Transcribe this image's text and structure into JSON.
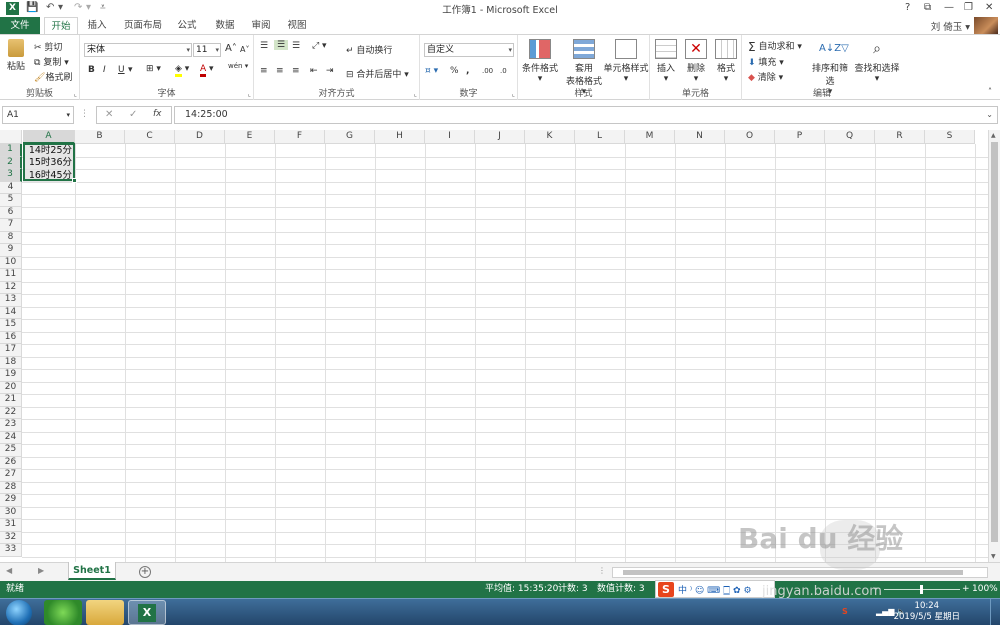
{
  "titlebar": {
    "title": "工作簿1 - Microsoft Excel",
    "help": "?",
    "ribbon_display": "⧉",
    "minimize": "—",
    "restore": "❐",
    "close": "✕"
  },
  "tabs": {
    "file": "文件",
    "items": [
      "开始",
      "插入",
      "页面布局",
      "公式",
      "数据",
      "审阅",
      "视图"
    ],
    "active": "开始",
    "user": "刘 倚玉 ▾"
  },
  "ribbon": {
    "clipboard": {
      "label": "剪贴板",
      "paste": "粘贴",
      "cut": "剪切",
      "copy": "复制",
      "format_painter": "格式刷"
    },
    "font": {
      "label": "字体",
      "font_name": "宋体",
      "font_size": "11",
      "bold": "B",
      "italic": "I",
      "underline": "U",
      "grow": "A",
      "shrink": "A",
      "wen": "wén"
    },
    "alignment": {
      "label": "对齐方式",
      "wrap": "自动换行",
      "merge": "合并后居中"
    },
    "number": {
      "label": "数字",
      "format": "自定义",
      "percent": "%",
      "comma": ",",
      "inc_dec": ".00",
      "dec_dec": ".0"
    },
    "styles": {
      "label": "样式",
      "cond": "条件格式",
      "table": "套用",
      "table2": "表格格式",
      "cell_styles": "单元格样式"
    },
    "cells": {
      "label": "单元格",
      "insert": "插入",
      "delete": "删除",
      "format": "格式"
    },
    "editing": {
      "label": "编辑",
      "autosum": "自动求和",
      "fill": "填充",
      "clear": "清除",
      "sort": "排序和筛选",
      "find": "查找和选择"
    }
  },
  "formula_bar": {
    "name_box": "A1",
    "cancel": "✕",
    "enter": "✓",
    "fx": "fx",
    "value": "14:25:00"
  },
  "columns": [
    "A",
    "B",
    "C",
    "D",
    "E",
    "F",
    "G",
    "H",
    "I",
    "J",
    "K",
    "L",
    "M",
    "N",
    "O",
    "P",
    "Q",
    "R",
    "S"
  ],
  "rows": [
    "1",
    "2",
    "3",
    "4",
    "5",
    "6",
    "7",
    "8",
    "9",
    "10",
    "11",
    "12",
    "13",
    "14",
    "15",
    "16",
    "17",
    "18",
    "19",
    "20",
    "21",
    "22",
    "23",
    "24",
    "25",
    "26",
    "27",
    "28",
    "29",
    "30",
    "31",
    "32",
    "33"
  ],
  "cells": {
    "A1": "14时25分",
    "A2": "15时36分",
    "A3": "16时45分"
  },
  "sheets": {
    "active": "Sheet1",
    "add": "+"
  },
  "status": {
    "ready": "就绪",
    "average": "平均值: 15:35:20",
    "count": "计数: 3",
    "numeric_count": "数值计数: 3",
    "zoom": "100%"
  },
  "ime": {
    "logo": "S",
    "mode": "中 ⁾ ☺ ⌨ 🀆 ✿ ⚙"
  },
  "watermark": {
    "main": "Bai du 经验",
    "url": "jingyan.baidu.com"
  },
  "taskbar": {
    "time": "10:24",
    "date": "2019/5/5 星期日"
  }
}
